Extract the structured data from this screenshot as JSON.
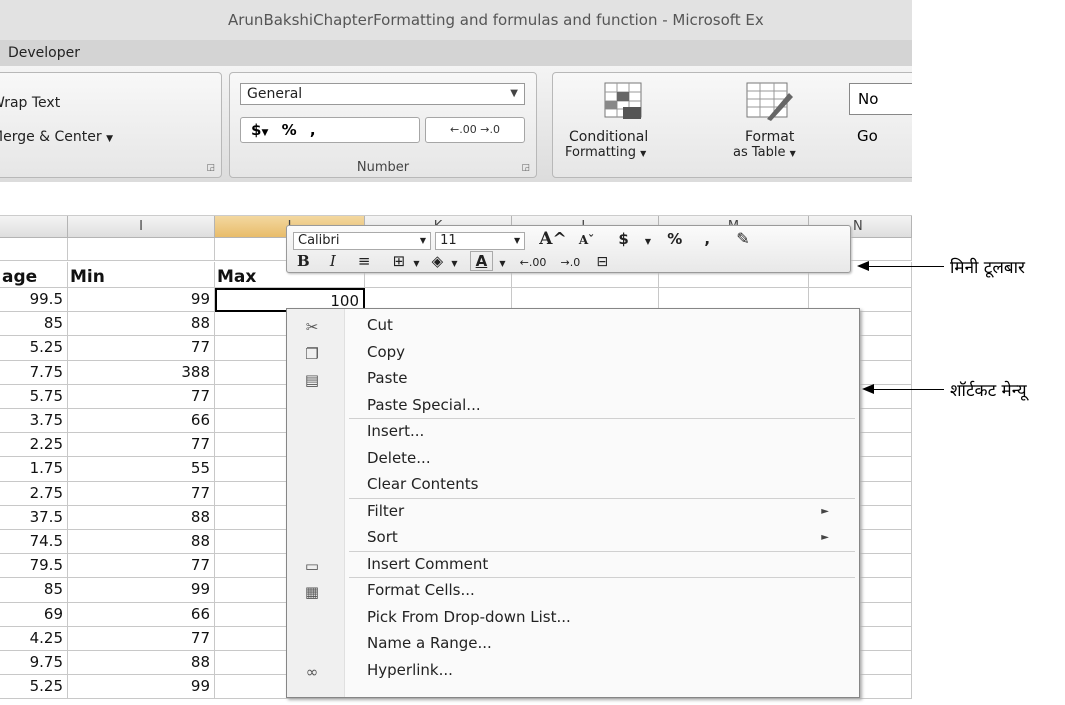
{
  "window": {
    "title": "ArunBakshiChapterFormatting and formulas and function - Microsoft Ex"
  },
  "ribbon": {
    "tab_developer": "Developer",
    "alignment": {
      "wrap_text": "Wrap Text",
      "merge_center": "Merge & Center"
    },
    "number": {
      "format_value": "General",
      "currency": "$",
      "percent": "%",
      "comma": ",",
      "increase_decimal": ".00",
      "decrease_decimal": ".0",
      "group_label": "Number"
    },
    "styles": {
      "conditional_formatting": "Conditional",
      "conditional_formatting_2": "Formatting",
      "format_as_table": "Format",
      "format_as_table_2": "as Table",
      "normal_cell": "No",
      "good_cell": "Go"
    }
  },
  "columns": [
    "I",
    "J",
    "K",
    "L",
    "M",
    "N"
  ],
  "sheet": {
    "headers": {
      "average": "age",
      "min": "Min",
      "max": "Max"
    },
    "rows": [
      {
        "average": "99.5",
        "min": "99",
        "max": "100"
      },
      {
        "average": "85",
        "min": "88",
        "max": ""
      },
      {
        "average": "5.25",
        "min": "77",
        "max": ""
      },
      {
        "average": "7.75",
        "min": "388",
        "max": ""
      },
      {
        "average": "5.75",
        "min": "77",
        "max": ""
      },
      {
        "average": "3.75",
        "min": "66",
        "max": ""
      },
      {
        "average": "2.25",
        "min": "77",
        "max": ""
      },
      {
        "average": "1.75",
        "min": "55",
        "max": ""
      },
      {
        "average": "2.75",
        "min": "77",
        "max": ""
      },
      {
        "average": "37.5",
        "min": "88",
        "max": ""
      },
      {
        "average": "74.5",
        "min": "88",
        "max": ""
      },
      {
        "average": "79.5",
        "min": "77",
        "max": ""
      },
      {
        "average": "85",
        "min": "99",
        "max": ""
      },
      {
        "average": "69",
        "min": "66",
        "max": ""
      },
      {
        "average": "4.25",
        "min": "77",
        "max": ""
      },
      {
        "average": "9.75",
        "min": "88",
        "max": ""
      },
      {
        "average": "5.25",
        "min": "99",
        "max": ""
      }
    ]
  },
  "mini_toolbar": {
    "font": "Calibri",
    "size": "11",
    "grow_font": "A^",
    "shrink_font": "Aˇ",
    "currency": "$",
    "percent": "%",
    "comma": ",",
    "bold": "B",
    "italic": "I"
  },
  "context_menu": {
    "items": [
      {
        "label": "Cut",
        "icon": "scissors-icon"
      },
      {
        "label": "Copy",
        "icon": "copy-icon"
      },
      {
        "label": "Paste",
        "icon": "paste-icon"
      },
      {
        "label": "Paste Special...",
        "icon": ""
      },
      {
        "label": "Insert...",
        "icon": ""
      },
      {
        "label": "Delete...",
        "icon": ""
      },
      {
        "label": "Clear Contents",
        "icon": ""
      },
      {
        "label": "Filter",
        "icon": "",
        "submenu": true
      },
      {
        "label": "Sort",
        "icon": "",
        "submenu": true
      },
      {
        "label": "Insert Comment",
        "icon": "comment-icon"
      },
      {
        "label": "Format Cells...",
        "icon": "format-cells-icon"
      },
      {
        "label": "Pick From Drop-down List...",
        "icon": ""
      },
      {
        "label": "Name a Range...",
        "icon": ""
      },
      {
        "label": "Hyperlink...",
        "icon": "hyperlink-icon"
      }
    ]
  },
  "callouts": {
    "mini_toolbar": "मिनी टूलबार",
    "shortcut_menu": "शॉर्टकट मेन्यू"
  }
}
